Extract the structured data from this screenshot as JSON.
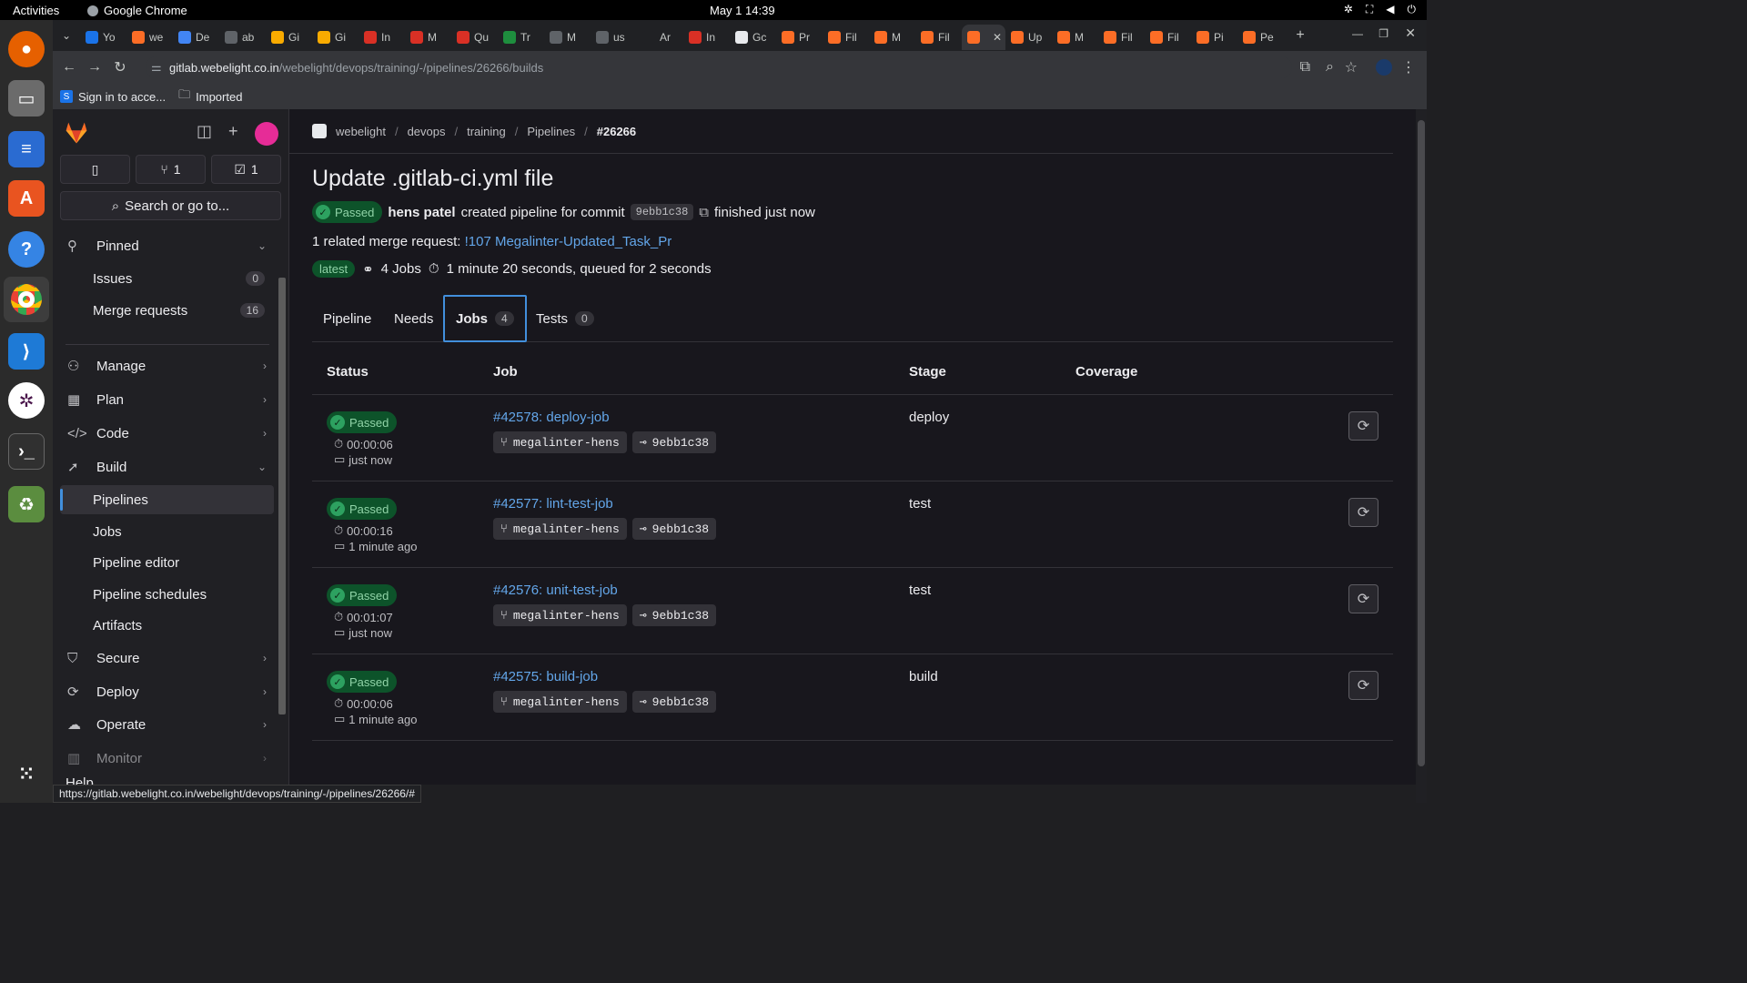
{
  "system": {
    "activities": "Activities",
    "app_name": "Google Chrome",
    "clock": "May 1  14:39"
  },
  "browser": {
    "tabs": [
      "Yo",
      "we",
      "De",
      "ab",
      "Gi",
      "Gi",
      "In",
      "M",
      "Qu",
      "Tr",
      "M",
      "us",
      "Ar",
      "In",
      "Gc",
      "Pr",
      "Fil",
      "M",
      "Fil",
      "",
      "Up",
      "M",
      "Fil",
      "Fil",
      "Pi",
      "Pe"
    ],
    "url_host": "gitlab.webelight.co.in",
    "url_path": "/webelight/devops/training/-/pipelines/26266/builds",
    "bookmarks": [
      "Sign in to acce...",
      "Imported"
    ],
    "status_url": "https://gitlab.webelight.co.in/webelight/devops/training/-/pipelines/26266/#"
  },
  "sidebar": {
    "counters": [
      {
        "icon": "merge-request-icon",
        "value": "1"
      },
      {
        "icon": "todo-icon",
        "value": "1"
      }
    ],
    "search_label": "Search or go to...",
    "pinned": "Pinned",
    "pinned_items": [
      {
        "label": "Issues",
        "count": "0"
      },
      {
        "label": "Merge requests",
        "count": "16"
      }
    ],
    "sections": [
      "Manage",
      "Plan",
      "Code",
      "Build"
    ],
    "build_items": [
      "Pipelines",
      "Jobs",
      "Pipeline editor",
      "Pipeline schedules",
      "Artifacts"
    ],
    "lower_sections": [
      "Secure",
      "Deploy",
      "Operate",
      "Monitor"
    ],
    "help": "Help"
  },
  "breadcrumb": [
    "webelight",
    "devops",
    "training",
    "Pipelines",
    "#26266"
  ],
  "pipeline": {
    "title": "Update .gitlab-ci.yml file",
    "status": "Passed",
    "author": "hens patel",
    "created_text": "created pipeline for commit",
    "commit": "9ebb1c38",
    "finished": "finished just now",
    "related_prefix": "1 related merge request:",
    "related_link": "!107 Megalinter-Updated_Task_Pr",
    "latest": "latest",
    "jobs_count": "4 Jobs",
    "duration": "1 minute 20 seconds, queued for 2 seconds"
  },
  "tabs": [
    {
      "label": "Pipeline",
      "count": ""
    },
    {
      "label": "Needs",
      "count": ""
    },
    {
      "label": "Jobs",
      "count": "4"
    },
    {
      "label": "Tests",
      "count": "0"
    }
  ],
  "table": {
    "headers": [
      "Status",
      "Job",
      "Stage",
      "Coverage"
    ],
    "rows": [
      {
        "status": "Passed",
        "duration": "00:00:06",
        "ago": "just now",
        "job": "#42578: deploy-job",
        "branch": "megalinter-hens",
        "sha": "9ebb1c38",
        "stage": "deploy"
      },
      {
        "status": "Passed",
        "duration": "00:00:16",
        "ago": "1 minute ago",
        "job": "#42577: lint-test-job",
        "branch": "megalinter-hens",
        "sha": "9ebb1c38",
        "stage": "test"
      },
      {
        "status": "Passed",
        "duration": "00:01:07",
        "ago": "just now",
        "job": "#42576: unit-test-job",
        "branch": "megalinter-hens",
        "sha": "9ebb1c38",
        "stage": "test"
      },
      {
        "status": "Passed",
        "duration": "00:00:06",
        "ago": "1 minute ago",
        "job": "#42575: build-job",
        "branch": "megalinter-hens",
        "sha": "9ebb1c38",
        "stage": "build"
      }
    ]
  }
}
